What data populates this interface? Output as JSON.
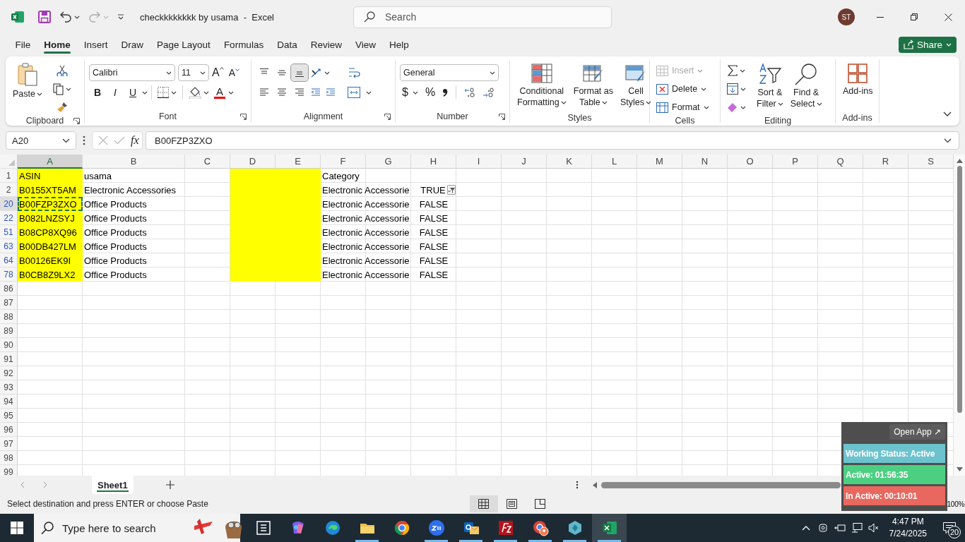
{
  "window": {
    "title": "checkkkkkkkk by usama  -  Excel",
    "search_placeholder": "Search",
    "user_initials": "ST"
  },
  "menu_tabs": [
    {
      "label": "File",
      "selected": false
    },
    {
      "label": "Home",
      "selected": true
    },
    {
      "label": "Insert",
      "selected": false
    },
    {
      "label": "Draw",
      "selected": false
    },
    {
      "label": "Page Layout",
      "selected": false
    },
    {
      "label": "Formulas",
      "selected": false
    },
    {
      "label": "Data",
      "selected": false
    },
    {
      "label": "Review",
      "selected": false
    },
    {
      "label": "View",
      "selected": false
    },
    {
      "label": "Help",
      "selected": false
    }
  ],
  "share_button": "Share",
  "ribbon": {
    "groups": [
      {
        "label": "Clipboard",
        "dialog_launcher": true,
        "paste_button": "Paste"
      },
      {
        "label": "Font",
        "dialog_launcher": true,
        "font_name": "Calibri",
        "font_size": "11",
        "grow_button": "A",
        "shrink_button": "A",
        "style_buttons": [
          "B",
          "I",
          "U"
        ],
        "font_color_button": "A"
      },
      {
        "label": "Alignment",
        "dialog_launcher": true,
        "vertical_align_buttons": [
          {
            "selected": false
          },
          {
            "selected": false
          },
          {
            "selected": true
          }
        ]
      },
      {
        "label": "Number",
        "dialog_launcher": true,
        "format": "General",
        "currency_button": "$",
        "percent_button": "%"
      },
      {
        "label": "Styles",
        "buttons": [
          "Conditional\nFormatting",
          "Format as\nTable",
          "Cell\nStyles"
        ]
      },
      {
        "label": "Cells",
        "buttons": [
          {
            "label": "Insert",
            "disabled": true
          },
          {
            "label": "Delete",
            "disabled": false
          },
          {
            "label": "Format",
            "disabled": false
          }
        ]
      },
      {
        "label": "Editing",
        "buttons": [
          "Sort &\nFilter",
          "Find &\nSelect"
        ]
      },
      {
        "label": "Add-ins",
        "buttons": [
          "Add-ins"
        ]
      }
    ]
  },
  "formula_bar": {
    "name_box": "A20",
    "function_button": "fx",
    "formula": "B00FZP3ZXO"
  },
  "columns": [
    {
      "label": "A",
      "selected": true,
      "highlighted": true
    },
    {
      "label": "B",
      "selected": false,
      "highlighted": false
    },
    {
      "label": "C",
      "selected": false,
      "highlighted": false
    },
    {
      "label": "D",
      "selected": false,
      "highlighted": true
    },
    {
      "label": "E",
      "selected": false,
      "highlighted": true
    },
    {
      "label": "F",
      "selected": false,
      "highlighted": false
    },
    {
      "label": "G",
      "selected": false,
      "highlighted": false
    },
    {
      "label": "H",
      "selected": false,
      "highlighted": false
    },
    {
      "label": "I",
      "selected": false,
      "highlighted": false
    },
    {
      "label": "J",
      "selected": false,
      "highlighted": false
    },
    {
      "label": "K",
      "selected": false,
      "highlighted": false
    },
    {
      "label": "L",
      "selected": false,
      "highlighted": false
    },
    {
      "label": "M",
      "selected": false,
      "highlighted": false
    },
    {
      "label": "N",
      "selected": false,
      "highlighted": false
    },
    {
      "label": "O",
      "selected": false,
      "highlighted": false
    },
    {
      "label": "P",
      "selected": false,
      "highlighted": false
    },
    {
      "label": "Q",
      "selected": false,
      "highlighted": false
    },
    {
      "label": "R",
      "selected": false,
      "highlighted": false
    },
    {
      "label": "S",
      "selected": false,
      "highlighted": false
    }
  ],
  "rows": [
    {
      "label": "1",
      "filtered": false,
      "selected": false,
      "highlighted": true,
      "cells": {
        "A": "ASIN",
        "B": "usama",
        "F": "Category"
      }
    },
    {
      "label": "2",
      "filtered": false,
      "selected": false,
      "highlighted": true,
      "cells": {
        "A": "B0155XT5AM",
        "B": "Electronic Accessories",
        "F": "Electronic Accessorie",
        "H": {
          "text": "TRUE",
          "filter_button": true
        }
      }
    },
    {
      "label": "20",
      "filtered": true,
      "selected": true,
      "highlighted": true,
      "cells": {
        "A": "B00FZP3ZXO",
        "B": "Office Products",
        "F": "Electronic Accessorie",
        "H": "FALSE"
      }
    },
    {
      "label": "22",
      "filtered": true,
      "selected": false,
      "highlighted": true,
      "cells": {
        "A": "B082LNZSYJ",
        "B": "Office Products",
        "F": "Electronic Accessorie",
        "H": "FALSE"
      }
    },
    {
      "label": "51",
      "filtered": true,
      "selected": false,
      "highlighted": true,
      "cells": {
        "A": "B08CP8XQ96",
        "B": "Office Products",
        "F": "Electronic Accessorie",
        "H": "FALSE"
      }
    },
    {
      "label": "63",
      "filtered": true,
      "selected": false,
      "highlighted": true,
      "cells": {
        "A": "B00DB427LM",
        "B": "Office Products",
        "F": "Electronic Accessorie",
        "H": "FALSE"
      }
    },
    {
      "label": "64",
      "filtered": true,
      "selected": false,
      "highlighted": true,
      "cells": {
        "A": "B00126EK9I",
        "B": "Office Products",
        "F": "Electronic Accessorie",
        "H": "FALSE"
      }
    },
    {
      "label": "78",
      "filtered": true,
      "selected": false,
      "highlighted": true,
      "cells": {
        "A": "B0CB8Z9LX2",
        "B": "Office Products",
        "F": "Electronic Accessorie",
        "H": "FALSE"
      }
    },
    {
      "label": "86",
      "filtered": false,
      "selected": false,
      "highlighted": false
    },
    {
      "label": "87",
      "filtered": false,
      "selected": false,
      "highlighted": false
    },
    {
      "label": "88",
      "filtered": false,
      "selected": false,
      "highlighted": false
    },
    {
      "label": "89",
      "filtered": false,
      "selected": false,
      "highlighted": false
    },
    {
      "label": "90",
      "filtered": false,
      "selected": false,
      "highlighted": false
    },
    {
      "label": "91",
      "filtered": false,
      "selected": false,
      "highlighted": false
    },
    {
      "label": "92",
      "filtered": false,
      "selected": false,
      "highlighted": false
    },
    {
      "label": "93",
      "filtered": false,
      "selected": false,
      "highlighted": false
    },
    {
      "label": "94",
      "filtered": false,
      "selected": false,
      "highlighted": false
    },
    {
      "label": "95",
      "filtered": false,
      "selected": false,
      "highlighted": false
    },
    {
      "label": "96",
      "filtered": false,
      "selected": false,
      "highlighted": false
    },
    {
      "label": "97",
      "filtered": false,
      "selected": false,
      "highlighted": false
    },
    {
      "label": "98",
      "filtered": false,
      "selected": false,
      "highlighted": false
    },
    {
      "label": "99",
      "filtered": false,
      "selected": false,
      "highlighted": false
    }
  ],
  "sheet_tabs": [
    {
      "label": "Sheet1",
      "selected": true
    }
  ],
  "status_bar": {
    "message": "Select destination and press ENTER or choose Paste",
    "view_buttons": [
      {
        "selected": true
      },
      {
        "selected": false
      },
      {
        "selected": false
      }
    ],
    "zoom": "100%"
  },
  "tracker": {
    "open_button": "Open App ↗",
    "statuses": [
      {
        "label": "Working Status: Active",
        "color": "#6cc3ce"
      },
      {
        "label": "Active: 01:56:35",
        "color": "#4dcf82"
      },
      {
        "label": "In Active: 00:10:01",
        "color": "#e8675e"
      }
    ]
  },
  "taskbar": {
    "search_placeholder": "Type here to search",
    "time": "4:47 PM",
    "date": "7/24/2025",
    "notifications": "20",
    "apps": [
      {
        "running": false,
        "selected": false
      },
      {
        "running": false,
        "selected": false
      },
      {
        "running": false,
        "selected": false
      },
      {
        "running": true,
        "selected": false
      },
      {
        "running": false,
        "selected": false
      },
      {
        "running": true,
        "selected": false
      },
      {
        "running": true,
        "selected": false
      },
      {
        "running": true,
        "selected": false
      },
      {
        "running": true,
        "selected": false
      },
      {
        "running": true,
        "selected": false
      },
      {
        "running": true,
        "selected": true
      }
    ]
  }
}
